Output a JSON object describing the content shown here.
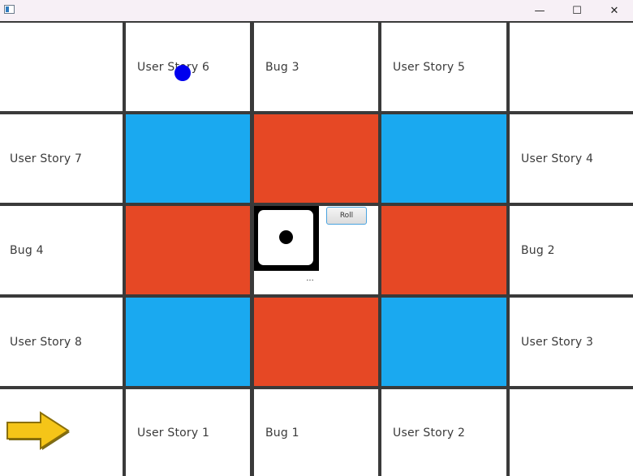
{
  "window": {
    "minimize_glyph": "—",
    "maximize_glyph": "☐",
    "close_glyph": "✕"
  },
  "board": {
    "row1": [
      "",
      "User Story 6",
      "Bug 3",
      "User Story 5",
      ""
    ],
    "row2_left": "User Story 7",
    "row2_right": "User Story 4",
    "row3_left": "Bug 4",
    "row3_right": "Bug 2",
    "row4_left": "User Story 8",
    "row4_right": "User Story 3",
    "row5": [
      "",
      "User Story 1",
      "Bug 1",
      "User Story 2",
      ""
    ],
    "colors": {
      "blue": "#1aa9f0",
      "red": "#e64825",
      "token": "#0000ee",
      "arrow": "#f5c518"
    }
  },
  "center": {
    "die_value": 1,
    "roll_label": "Roll",
    "status_text": "..."
  },
  "player_token": {
    "icon": "blue-circle",
    "tile": "User Story 6"
  },
  "start_marker": {
    "icon": "arrow-right-icon"
  }
}
